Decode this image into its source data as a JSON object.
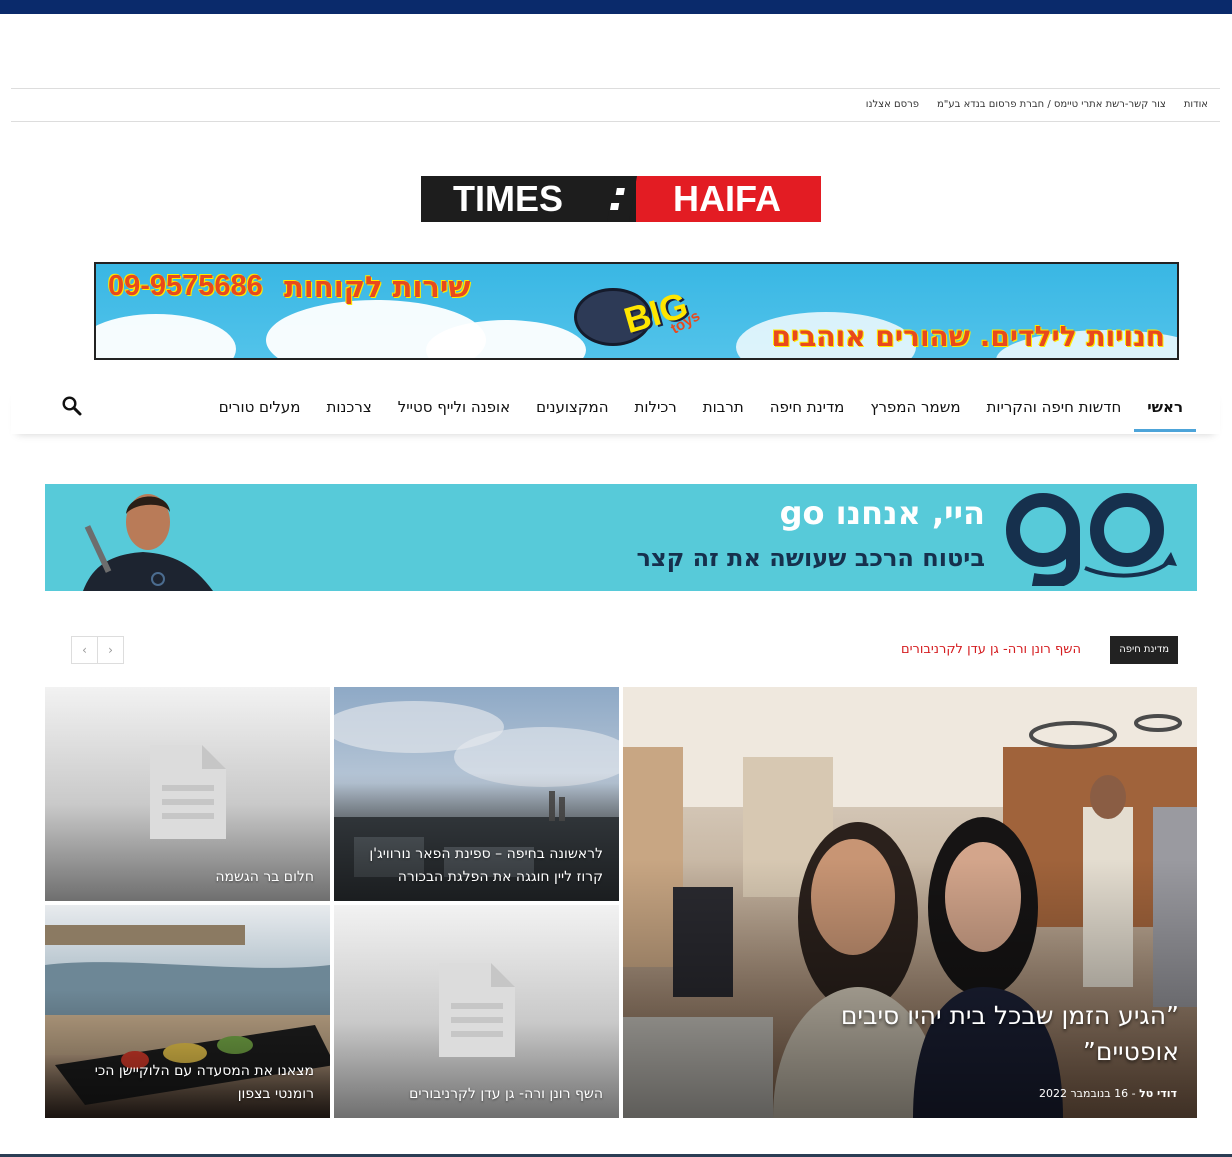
{
  "utility_links": [
    "אודות",
    "צור קשר-רשת אתרי טיימס / חברת פרסום בנדא בע\"מ",
    "פרסם אצלנו"
  ],
  "logo": {
    "left": "HAIFA",
    "right": "TIMES"
  },
  "banner_top": {
    "phone": "09-9575686",
    "headline": "שירות לקוחות",
    "tagline": "חנויות לילדים. שהורים אוהבים",
    "brand": "BIG",
    "brand_sub": "toys"
  },
  "nav": {
    "items": [
      "ראשי",
      "חדשות חיפה והקריות",
      "משמר המפרץ",
      "מדינת חיפה",
      "תרבות",
      "רכילות",
      "המקצוענים",
      "אופנה ולייף סטייל",
      "צרכנות",
      "מעלים טורים"
    ],
    "active_index": 0
  },
  "banner_go": {
    "title": "היי, אנחנו go",
    "subtitle": "ביטוח הרכב שעושה את זה קצר"
  },
  "ticker": {
    "label": "מדינת חיפה",
    "headline": "השף רונן ורה- גן עדן לקרניבורים"
  },
  "grid": {
    "featured": {
      "title": "”הגיע הזמן שבכל בית יהיו סיבים אופטיים”",
      "author": "דודי טל",
      "separator": "-",
      "date": "16 בנובמבר 2022"
    },
    "tiles": [
      {
        "title": "לראשונה בחיפה – ספינת הפאר נורוויג'ן קרוז ליין חוגגה את הפלגת הבכורה"
      },
      {
        "title": "חלום בר הגשמה"
      },
      {
        "title": "השף רונן ורה- גן עדן לקרניבורים"
      },
      {
        "title": "מצאנו את המסעדה עם הלוקיישן הכי רומנטי בצפון"
      }
    ]
  },
  "colors": {
    "topbar": "#0a2a6b",
    "logo_red": "#e31c23",
    "nav_active": "#4da4d9",
    "ticker_red": "#d51d20",
    "go_banner": "#57cad9"
  },
  "icons": [
    "search-icon",
    "chevron-left-icon",
    "chevron-right-icon",
    "document-placeholder-icon"
  ]
}
